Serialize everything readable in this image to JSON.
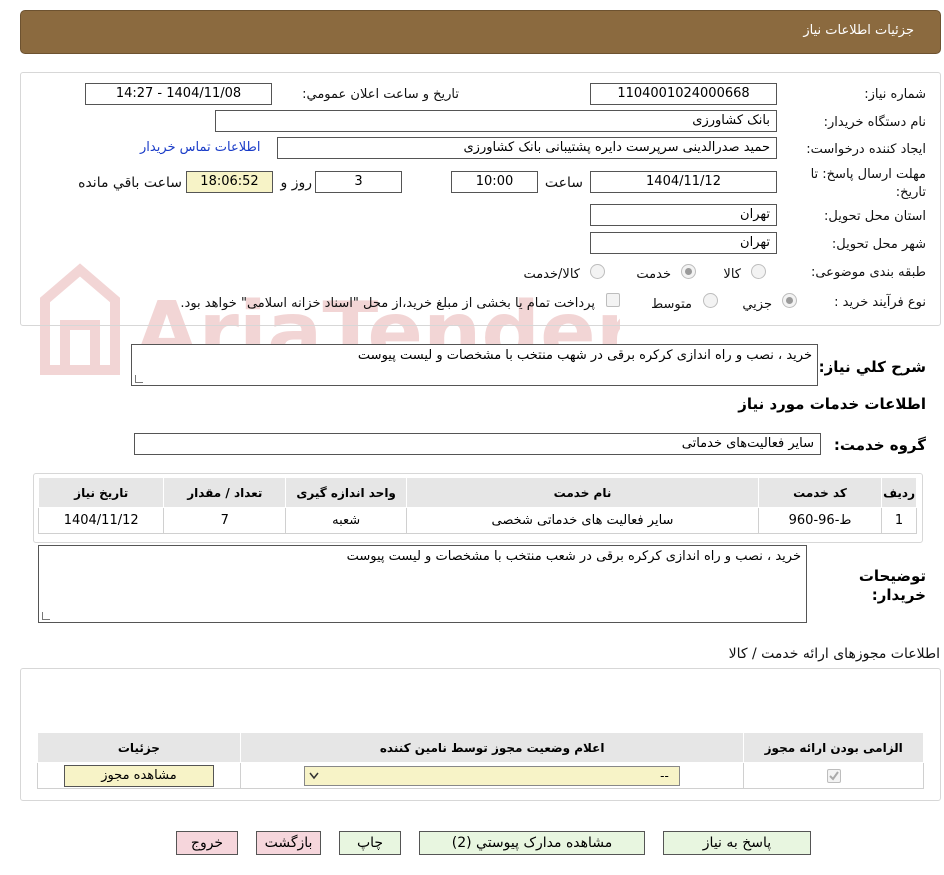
{
  "header": {
    "title": "جزئیات اطلاعات نیاز"
  },
  "form": {
    "need_number_label": "شماره نیاز:",
    "need_number": "1104001024000668",
    "announce_label": "تاریخ و ساعت اعلان عمومي:",
    "announce_value": "1404/11/08 - 14:27",
    "buyer_org_label": "نام دستگاه خریدار:",
    "buyer_org": "بانک کشاورزی",
    "requester_label": "ایجاد کننده درخواست:",
    "requester": "حمید صدرالدینی سرپرست دایره  پشتیبانی بانک کشاورزی",
    "contact_link": "اطلاعات تماس خریدار",
    "deadline_label": "مهلت ارسال پاسخ: تا تاریخ:",
    "deadline_date": "1404/11/12",
    "time_label": "ساعت",
    "deadline_time": "10:00",
    "days_value": "3",
    "days_label": "روز و",
    "remaining_time": "18:06:52",
    "remaining_label": "ساعت باقي مانده",
    "province_label": "استان محل تحویل:",
    "province": "تهران",
    "city_label": "شهر محل تحویل:",
    "city": "تهران",
    "category_label": "طبقه بندی موضوعی:",
    "category_options": [
      "کالا",
      "خدمت",
      "کالا/خدمت"
    ],
    "process_label": "نوع فرآیند خرید :",
    "process_options": [
      "جزيي",
      "متوسط"
    ],
    "payment_note": "پرداخت تمام یا بخشی از مبلغ خرید،از محل \"اسناد خزانه اسلامی\" خواهد بود."
  },
  "summary": {
    "label": "شرح کلي نیاز:",
    "text": "خرید ، نصب و راه اندازی کرکره برقی در شهب منتخب با مشخصات و لیست پیوست"
  },
  "services": {
    "section_title": "اطلاعات خدمات مورد نیاز",
    "group_label": "گروه خدمت:",
    "group_value": "سایر فعالیت‌های خدماتی",
    "columns": [
      "ردیف",
      "کد خدمت",
      "نام خدمت",
      "واحد اندازه گیری",
      "تعداد / مقدار",
      "تاریخ نیاز"
    ],
    "rows": [
      [
        "1",
        "ط-96-960",
        "سایر فعالیت های خدماتی شخصی",
        "شعبه",
        "7",
        "1404/11/12"
      ]
    ]
  },
  "buyer_notes": {
    "label": "توضیحات خریدار:",
    "text": "خرید ، نصب و راه اندازی کرکره برقی در شعب منتخب با مشخصات و لیست پیوست"
  },
  "licenses": {
    "section_title": "اطلاعات مجوزهای ارائه خدمت / کالا",
    "columns": [
      "الزامی بودن ارائه مجوز",
      "اعلام وضعیت مجوز توسط نامین کننده",
      "جزئیات"
    ],
    "select_value": "--",
    "view_button": "مشاهده مجوز"
  },
  "actions": {
    "reply": "پاسخ به نیاز",
    "view_docs": "مشاهده مدارک پیوستي (2)",
    "print": "چاپ",
    "back": "بازگشت",
    "exit": "خروج"
  },
  "watermark": {
    "text": "AriaTender.neT"
  },
  "colors": {
    "header": "#8b6a3f",
    "link": "#1a3cc8",
    "button_green": "#e8f6e0",
    "button_pink": "#f6d6dc",
    "highlight": "#f7f3c7"
  }
}
